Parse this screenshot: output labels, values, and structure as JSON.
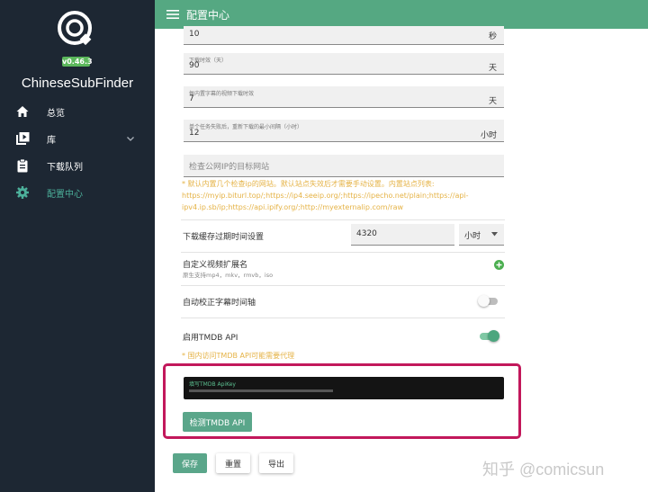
{
  "sidebar": {
    "version": "v0.46.3",
    "app_name": "ChineseSubFinder",
    "items": [
      {
        "label": "总览",
        "icon": "home-icon"
      },
      {
        "label": "库",
        "icon": "library-icon"
      },
      {
        "label": "下载队列",
        "icon": "clipboard-icon"
      },
      {
        "label": "配置中心",
        "icon": "gear-icon"
      }
    ]
  },
  "topbar": {
    "title": "配置中心",
    "icon": "menu-icon"
  },
  "form": {
    "field1": {
      "value": "10",
      "unit": "秒"
    },
    "field2": {
      "label": "下载时效（天）",
      "value": "90",
      "unit": "天"
    },
    "field3": {
      "label": "每内置字幕的视频下载时效",
      "value": "7",
      "unit": "天"
    },
    "field4": {
      "label": "单个任务失败后，重新下载的最小间隔（小时）",
      "value": "12",
      "unit": "小时"
    },
    "ip_check": {
      "placeholder": "检查公网IP的目标网站",
      "hint": "* 默认内置几个检查ip的网站。默认站点失效后才需要手动设置。内置站点列表: https://myip.biturl.top/;https://ip4.seeip.org/;https://ipecho.net/plain;https://api-ipv4.ip.sb/ip;https://api.ipify.org/;http://myexternalip.com/raw"
    },
    "cache_expire": {
      "label": "下载缓存过期时间设置",
      "value": "4320",
      "unit": "小时"
    },
    "custom_ext": {
      "label": "自定义视频扩展名",
      "sub": "原生支持mp4，mkv，rmvb，iso"
    },
    "auto_fix": {
      "label": "自动校正字幕时间轴",
      "enabled": false
    },
    "tmdb": {
      "label": "启用TMDB API",
      "enabled": true,
      "hint": "* 国内访问TMDB API可能需要代理",
      "apikey_label": "填写TMDB ApiKey",
      "check_button": "检测TMDB API"
    }
  },
  "actions": {
    "save": "保存",
    "reset": "重置",
    "export": "导出"
  },
  "watermark": "知乎 @comicsun",
  "colors": {
    "accent": "#55a882",
    "sidebar": "#1d2733",
    "hint": "#e5b347",
    "highlight": "#c2185b"
  }
}
